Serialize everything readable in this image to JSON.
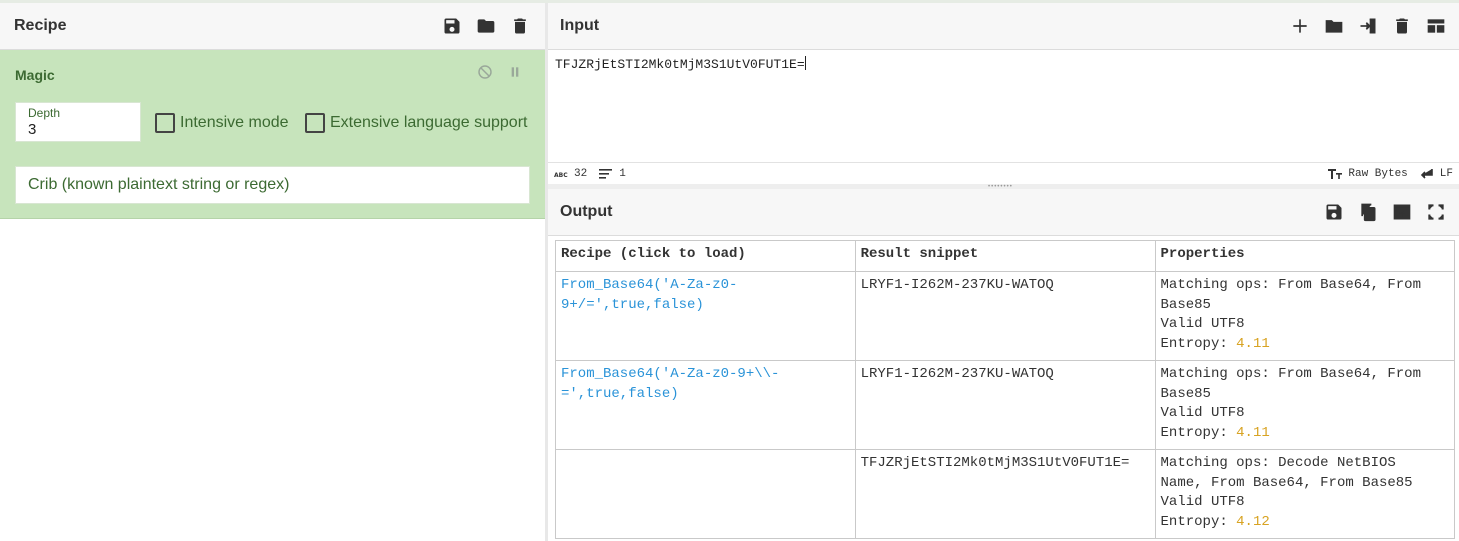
{
  "recipe_panel": {
    "title": "Recipe",
    "operation": {
      "title": "Magic",
      "depth_label": "Depth",
      "depth_value": "3",
      "intensive_label": "Intensive mode",
      "extensive_label": "Extensive language support",
      "crib_placeholder": "Crib (known plaintext string or regex)"
    }
  },
  "input_panel": {
    "title": "Input",
    "text": "TFJZRjEtSTI2Mk0tMjM3S1UtV0FUT1E=",
    "status": {
      "length": "32",
      "lines": "1",
      "encoding": "Raw Bytes",
      "eol": "LF"
    }
  },
  "output_panel": {
    "title": "Output",
    "table": {
      "headers": [
        "Recipe (click to load)",
        "Result snippet",
        "Properties"
      ],
      "rows": [
        {
          "recipe_l1": "From_Base64('A-Za-z0-",
          "recipe_l2": "9+/=',true,false)",
          "snippet": "LRYF1-I262M-237KU-WATOQ",
          "ops_l1": "Matching ops: From Base64, From",
          "ops_l2": "Base85",
          "utf8": "Valid UTF8",
          "entropy_label": "Entropy: ",
          "entropy_value": "4.11"
        },
        {
          "recipe_l1": "From_Base64('A-Za-z0-9+\\\\-",
          "recipe_l2": "=',true,false)",
          "snippet": "LRYF1-I262M-237KU-WATOQ",
          "ops_l1": "Matching ops: From Base64, From",
          "ops_l2": "Base85",
          "utf8": "Valid UTF8",
          "entropy_label": "Entropy: ",
          "entropy_value": "4.11"
        },
        {
          "recipe_l1": "",
          "recipe_l2": "",
          "snippet": "TFJZRjEtSTI2Mk0tMjM3S1UtV0FUT1E=",
          "ops_l1": "Matching ops: Decode NetBIOS",
          "ops_l2": "Name, From Base64, From Base85",
          "utf8": "Valid UTF8",
          "entropy_label": "Entropy: ",
          "entropy_value": "4.12"
        }
      ]
    }
  },
  "colors": {
    "operation_bg": "#c7e4bc",
    "operation_text": "#3c6a32",
    "link": "#2a93d8",
    "entropy": "#d8a322"
  }
}
